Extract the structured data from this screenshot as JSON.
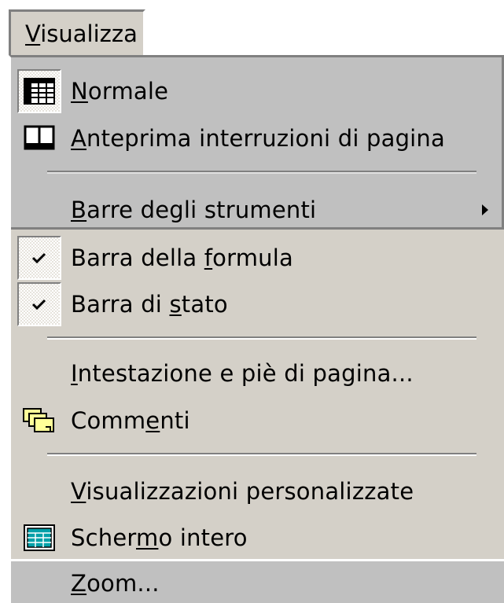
{
  "menu": {
    "title": {
      "pre": "",
      "key": "V",
      "post": "isualizza"
    },
    "items": [
      {
        "pre": "",
        "key": "N",
        "post": "ormale",
        "icon": "normal-view-grid-icon",
        "state": "selected-icon-frame"
      },
      {
        "pre": "",
        "key": "A",
        "post": "nteprima interruzioni di pagina",
        "icon": "page-break-preview-icon"
      },
      {
        "pre": "",
        "key": "B",
        "post": "arre degli strumenti",
        "submenu": true,
        "submenu_icon": "submenu-arrow-icon"
      },
      {
        "pre": "Barra della ",
        "key": "f",
        "post": "ormula",
        "checked": true,
        "icon": "check-icon"
      },
      {
        "pre": "Barra di ",
        "key": "s",
        "post": "tato",
        "checked": true,
        "icon": "check-icon"
      },
      {
        "pre": "",
        "key": "I",
        "post": "ntestazione e piè di pagina...",
        "icon": ""
      },
      {
        "pre": "Comm",
        "key": "e",
        "post": "nti",
        "icon": "comments-icon"
      },
      {
        "pre": "",
        "key": "V",
        "post": "isualizzazioni personalizzate",
        "icon": ""
      },
      {
        "pre": "Scher",
        "key": "m",
        "post": "o intero",
        "icon": "full-screen-icon"
      },
      {
        "pre": "",
        "key": "Z",
        "post": "oom...",
        "icon": ""
      }
    ]
  },
  "colors": {
    "menu_background": "#d4d0c8",
    "recent_background": "#c0c0c0",
    "comment_yellow": "#ffff99",
    "screen_teal": "#00a0a8"
  }
}
